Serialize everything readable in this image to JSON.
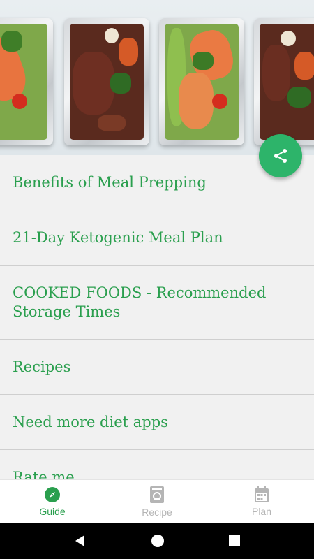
{
  "hero": {
    "image": "meal-prep-trays"
  },
  "fab": {
    "icon": "share-icon",
    "color": "#2db46a"
  },
  "menu": {
    "items": [
      {
        "label": "Benefits of Meal Prepping"
      },
      {
        "label": "21-Day Ketogenic Meal Plan"
      },
      {
        "label": "COOKED FOODS - Recommended Storage Times"
      },
      {
        "label": "Recipes"
      },
      {
        "label": "Need more diet apps"
      },
      {
        "label": "Rate me"
      }
    ]
  },
  "bottom_nav": {
    "tabs": [
      {
        "label": "Guide",
        "icon": "compass-icon",
        "active": true
      },
      {
        "label": "Recipe",
        "icon": "recipe-book-icon",
        "active": false
      },
      {
        "label": "Plan",
        "icon": "calendar-icon",
        "active": false
      }
    ]
  },
  "system_nav": {
    "back": "back-icon",
    "home": "home-icon",
    "recents": "recents-icon"
  },
  "colors": {
    "accent": "#2a9f4e",
    "fab": "#2db46a",
    "inactive": "#b5b5b5",
    "background": "#f1f1f1"
  }
}
